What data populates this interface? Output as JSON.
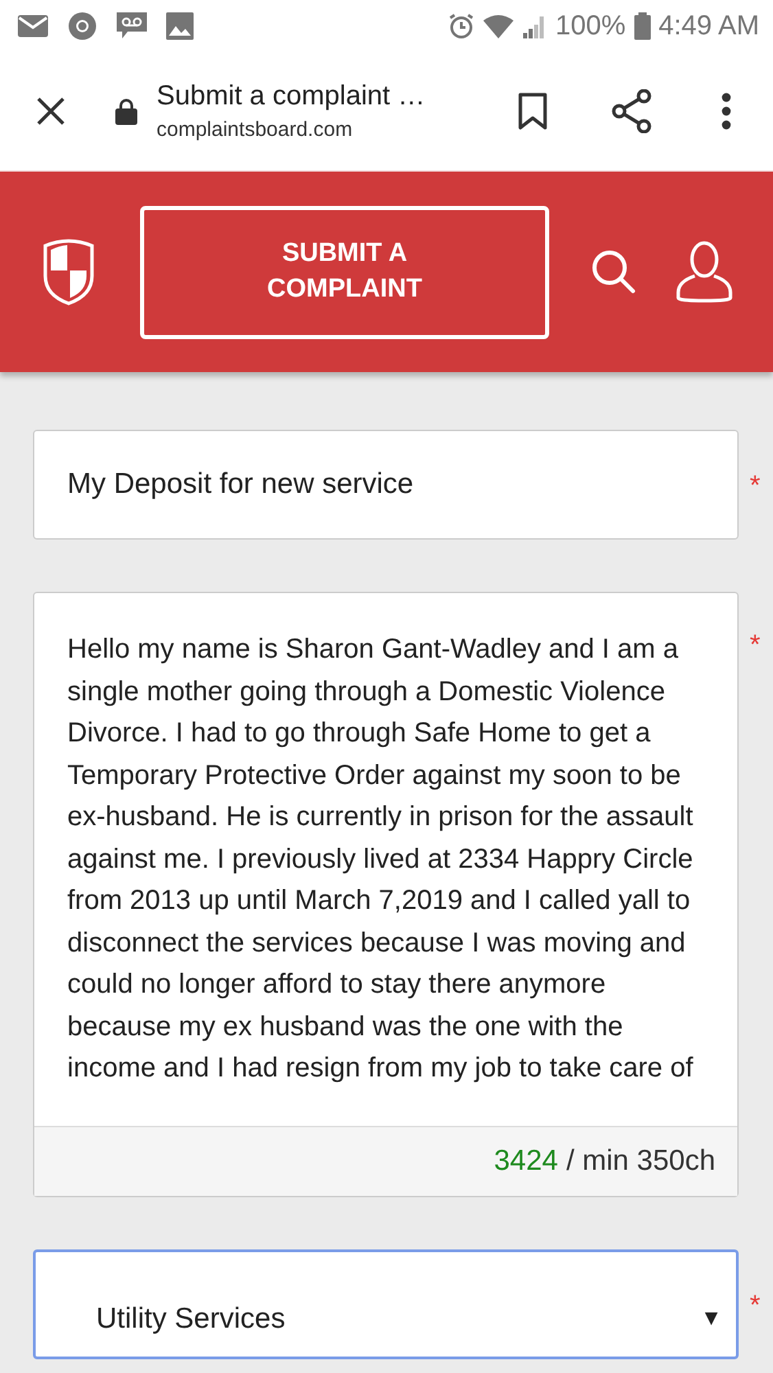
{
  "status_bar": {
    "battery": "100%",
    "time": "4:49 AM"
  },
  "browser": {
    "title": "Submit a complaint …",
    "url": "complaintsboard.com"
  },
  "header": {
    "button": "SUBMIT A COMPLAINT"
  },
  "form": {
    "subject": {
      "value": "My Deposit for new service",
      "required_mark": "*"
    },
    "description": {
      "value": "Hello my name is Sharon Gant-Wadley and I am a single mother going through a Domestic Violence Divorce. I had to go through Safe Home to get a Temporary Protective Order against my soon to be ex-husband. He is currently in prison for the assault against me. I previously lived at 2334 Happry Circle from 2013 up until March 7,2019 and I called yall to disconnect the services because I was moving and could no longer afford to stay there anymore because my ex husband was the one with the income and I had resign from my job to take care of",
      "required_mark": "*",
      "count": "3424",
      "limit": "/ min 350ch"
    },
    "category": {
      "value": "Utility Services",
      "caret": "▼",
      "required_mark": "*"
    }
  }
}
